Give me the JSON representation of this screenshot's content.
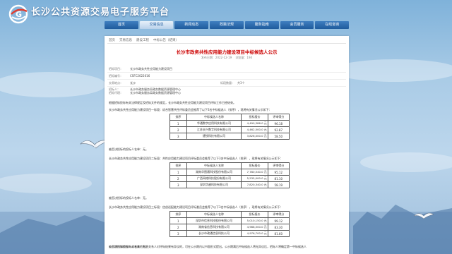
{
  "site": {
    "title": "长沙公共资源交易电子服务平台"
  },
  "nav": [
    "首页",
    "交易信息",
    "新闻动态",
    "政策法规",
    "服务指南",
    "会员服务",
    "在线咨询"
  ],
  "nav_active": 1,
  "breadcrumb": [
    "首页",
    "交易信息",
    "建设工程",
    "中标公告（结果）"
  ],
  "doc": {
    "title": "长沙市政务共性应用能力建设项目中标候选人公示",
    "meta": [
      "发布日期：2022-12-19",
      "浏览量：194"
    ],
    "info": [
      {
        "k": "招标项目：",
        "v": "长沙市政务共性应用能力建设项目"
      },
      {
        "k": "招标编号：",
        "v": "CSFC2022016"
      },
      {
        "k": "交易地点：",
        "v": "长沙",
        "k2": "标段数量：",
        "v2": "共3个"
      },
      {
        "k": "招标人：",
        "v": "长沙市政务服务局政务数据资源管理中心"
      },
      {
        "k": "招标代理：",
        "v": "长沙市政务服务局政务数据资源管理中心"
      }
    ],
    "intro": "根据招标投标有关法律规定及招标文件的规定，长沙市政务共性应用能力建设项目评标工作已经结束。",
    "sections": [
      {
        "heading": "长沙市政务共性应用能力建设项目一标段：综合智慧共性评标委员会推荐了以下3名中标候选人（排序），现将有关情况公示如下：",
        "rows": [
          {
            "rank": "1",
            "name": "华通数字应用科技有限公司",
            "amount": "4,490,386.0 元",
            "score": "96.18"
          },
          {
            "rank": "2",
            "name": "江苏长兴数字科技有限公司",
            "amount": "4,462,500.0 元",
            "score": "92.87"
          },
          {
            "rank": "3",
            "name": "捷锐科技有限公司",
            "amount": "3,826,000.0 元",
            "score": "58.50"
          }
        ],
        "note": "被否决投标的投标人名单：无。"
      },
      {
        "heading": "长沙市政务共性应用能力建设项目二标段：共性应用能力建设项目评标委员会推荐了以下3名中标候选人（排序），现将有关情况公示如下：",
        "rows": [
          {
            "rank": "1",
            "name": "湖南华图通科技股份有限公司",
            "amount": "7,780,540.0 元",
            "score": "95.12"
          },
          {
            "rank": "2",
            "name": "广西网络科技股份有限公司",
            "amount": "5,535,000.0 元",
            "score": "81.10"
          },
          {
            "rank": "3",
            "name": "深圳华越科技有限公司",
            "amount": "7,820,340.0 元",
            "score": "58.19"
          }
        ],
        "note": "被否决投标的投标人名单：无。"
      },
      {
        "heading": "长沙市政务共性应用能力建设项目三标段：信创适配能力建设项目评标委员会推荐了以下3名中标候选人（排序），现将有关情况公示如下：",
        "rows": [
          {
            "rank": "1",
            "name": "深圳市信息科技股份有限公司",
            "amount": "5,010,150.0 元",
            "score": "99.12"
          },
          {
            "rank": "2",
            "name": "湖南省信息科技有限公司",
            "amount": "4,988,500.0 元",
            "score": "83.30"
          },
          {
            "rank": "3",
            "name": "长沙市政通信息科技公司",
            "amount": "4,976,700.0 元",
            "score": "81.60"
          }
        ],
        "note": "被否决投标的投标人名单：无。"
      }
    ],
    "table_headers": [
      "排序",
      "中标候选人名称",
      "投标报价",
      "评审得分"
    ],
    "footer": "公示期内如投标人或者其他利害关系人对评标结果有异议的，可在公示期内以书面形式提出。公示期满后中标候选人将无异议后，招标人将确定第一中标候选人"
  }
}
